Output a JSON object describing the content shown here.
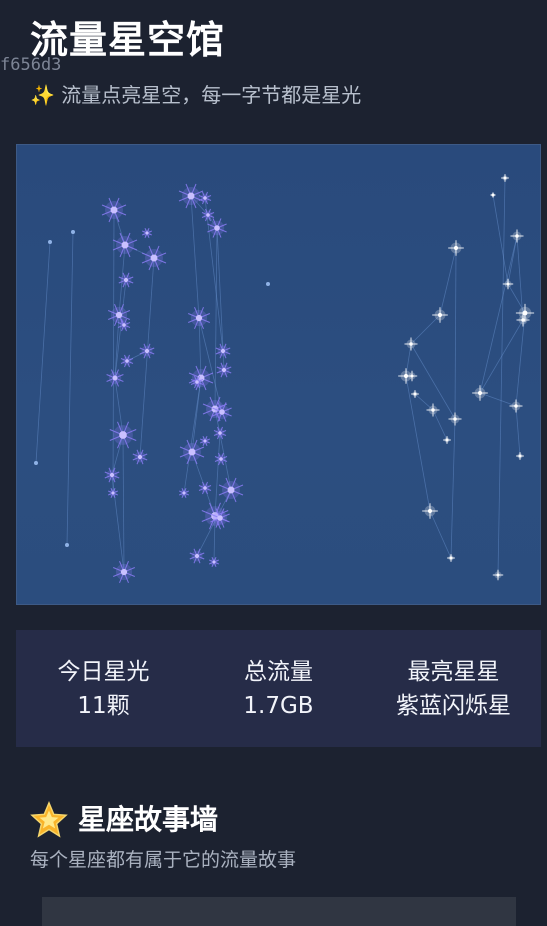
{
  "header": {
    "title": "流量星空馆",
    "overlay_text": "f656d3",
    "subtitle": "✨ 流量点亮星空，每一字节都是星光"
  },
  "sky": {
    "background_color": "#2b4c7e",
    "purple_star_color": "#8b7cf6",
    "white_star_color": "#ffffff"
  },
  "stats": {
    "today_label": "今日星光",
    "today_value": "11颗",
    "total_label": "总流量",
    "total_value": "1.7GB",
    "brightest_label": "最亮星星",
    "brightest_value": "紫蓝闪烁星"
  },
  "story": {
    "icon": "glowing-star-icon",
    "title": "星座故事墙",
    "subtitle": "每个星座都有属于它的流量故事"
  }
}
